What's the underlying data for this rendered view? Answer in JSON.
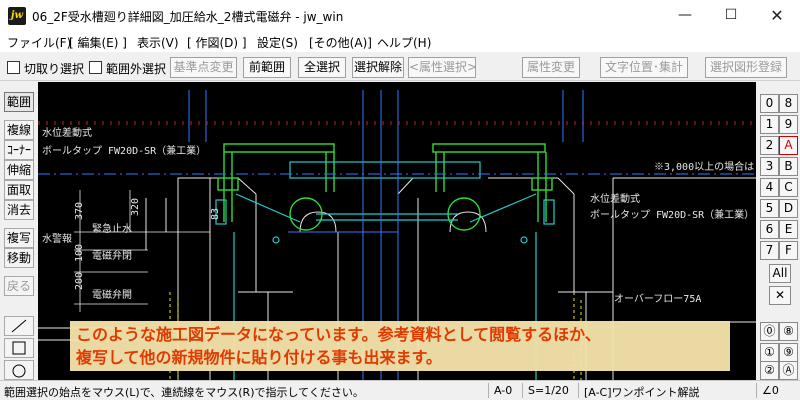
{
  "window": {
    "app_icon": "jw",
    "title": "06_2F受水槽廻り詳細図_加圧給水_2槽式電磁弁 - jw_win",
    "minimize_icon": "—",
    "maximize_icon": "☐",
    "close_icon": "✕"
  },
  "menu": [
    "ファイル(F)",
    "[ 編集(E) ]",
    "表示(V)",
    "[ 作図(D) ]",
    "設定(S)",
    "[その他(A)]",
    "ヘルプ(H)"
  ],
  "toolbar": {
    "check1": "切取り選択",
    "check2": "範囲外選択",
    "btn_base": "基準点変更",
    "btn_prev": "前範囲",
    "btn_all": "全選択",
    "btn_release": "選択解除",
    "btn_attr_sel": "<属性選択>",
    "btn_attr_change": "属性変更",
    "btn_text_pos": "文字位置･集計",
    "btn_register": "選択図形登録"
  },
  "left_tools": [
    "範囲",
    "複線",
    "ｺｰﾅｰ",
    "伸縮",
    "面取",
    "消去",
    "複写",
    "移動",
    "戻る"
  ],
  "right_tools": {
    "col1": [
      "0",
      "1",
      "2",
      "3",
      "4",
      "5",
      "6",
      "7"
    ],
    "col2": [
      "8",
      "9",
      "A",
      "B",
      "C",
      "D",
      "E",
      "F"
    ],
    "all": "All",
    "cross": "✕",
    "layer_col1": [
      "⓪",
      "①",
      "②"
    ],
    "layer_col2": [
      "⑧",
      "⑨",
      "Ⓐ"
    ]
  },
  "drawing": {
    "label_float1": "水位差動式",
    "label_float2": "ボールタップ FW20D-SR（兼工業）",
    "label_float3": "水位差動式",
    "label_float4": "ボールタップ FW20D-SR（兼工業）",
    "label_note": "※3,000以上の場合は",
    "label_emergency": "緊急止水",
    "label_alarm": "水警報",
    "label_valve_close": "電磁弁閉",
    "label_valve_open": "電磁弁開",
    "label_overflow": "オーバーフロー75A",
    "dim_370": "370",
    "dim_320": "320",
    "dim_83": "83",
    "dim_100": "100",
    "dim_200": "200"
  },
  "banner": {
    "line1": "このような施工図データになっています。参考資料として閲覧するほか、",
    "line2": "複写して他の新規物件に貼り付ける事も出来ます。"
  },
  "status": {
    "message": "範囲選択の始点をマウス(L)で、連続線をマウス(R)で指示してください。",
    "layer": "A-0",
    "scale": "S=1/20",
    "help": "[A-C]ワンポイント解説",
    "angle": "∠0"
  },
  "colors": {
    "canvas_bg": "#000000",
    "cad_white": "#e8e8e8",
    "cad_green": "#33dd33",
    "cad_cyan": "#22cccc",
    "cad_blue": "#3377ff",
    "cad_yellow": "#e8e800",
    "cad_red": "#cc2222",
    "banner_text": "#e03a00"
  }
}
